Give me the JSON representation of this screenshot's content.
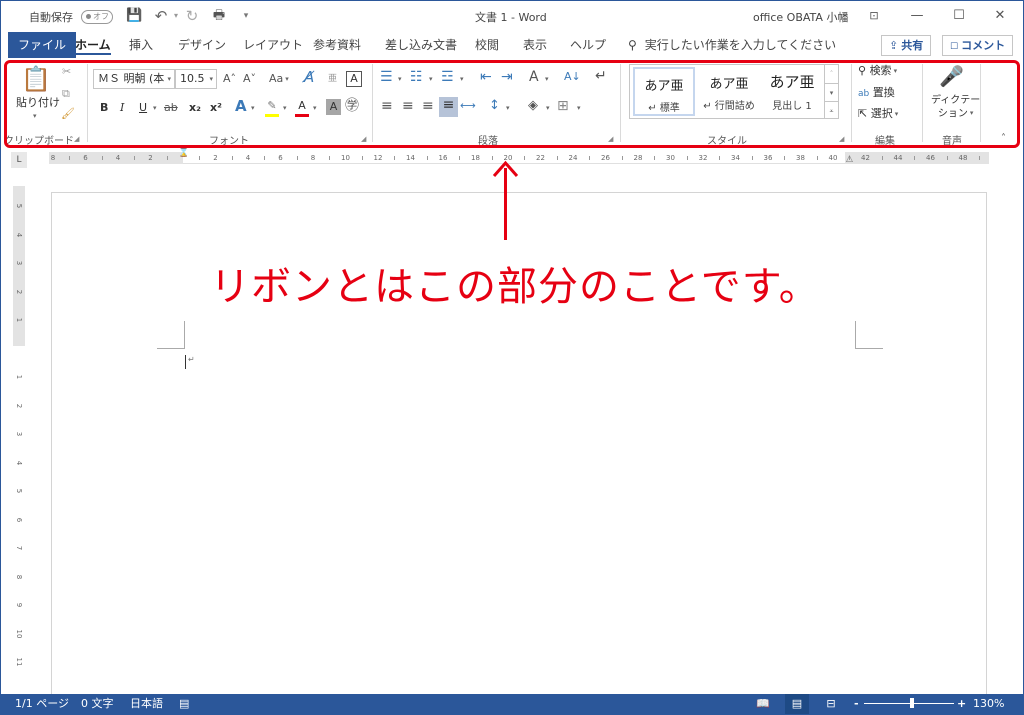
{
  "titlebar": {
    "autosave_label": "自動保存",
    "autosave_state": "オフ",
    "quick_access": [
      {
        "icon": "save-icon",
        "glyph": "💾"
      },
      {
        "icon": "undo-icon",
        "glyph": "↶"
      },
      {
        "icon": "redo-icon",
        "glyph": "↻"
      },
      {
        "icon": "print-preview-icon",
        "glyph": "🖶"
      },
      {
        "icon": "customize-qat-icon",
        "glyph": "▾"
      }
    ],
    "doc_title": "文書 1  -  Word",
    "user_name": "office OBATA 小幡",
    "ribbon_display_glyph": "⊡",
    "minimize_glyph": "—",
    "maximize_glyph": "☐",
    "close_glyph": "✕"
  },
  "tabs": [
    {
      "label": "ファイル",
      "id": "file"
    },
    {
      "label": "ホーム",
      "id": "home",
      "active": true
    },
    {
      "label": "挿入",
      "id": "insert"
    },
    {
      "label": "デザイン",
      "id": "design"
    },
    {
      "label": "レイアウト",
      "id": "layout"
    },
    {
      "label": "参考資料",
      "id": "references"
    },
    {
      "label": "差し込み文書",
      "id": "mailings"
    },
    {
      "label": "校閲",
      "id": "review"
    },
    {
      "label": "表示",
      "id": "view"
    },
    {
      "label": "ヘルプ",
      "id": "help"
    }
  ],
  "tell_me": {
    "icon": "search-icon",
    "glyph": "⚲",
    "placeholder": "実行したい作業を入力してください"
  },
  "share_button": {
    "glyph": "⇪",
    "label": "共有"
  },
  "comment_button": {
    "glyph": "☐",
    "label": "コメント"
  },
  "ribbon": {
    "groups": {
      "clipboard": "クリップボード",
      "font": "フォント",
      "paragraph": "段落",
      "styles": "スタイル",
      "editing": "編集",
      "voice": "音声"
    },
    "clipboard": {
      "paste_label": "貼り付け",
      "paste_glyph": "📋",
      "cut_glyph": "✂",
      "copy_glyph": "⧉",
      "format_painter_glyph": "🖌"
    },
    "font": {
      "font_name": "ＭＳ 明朝 (本",
      "font_size": "10.5",
      "grow_glyph": "A˄",
      "shrink_glyph": "A˅",
      "change_case_label": "Aa",
      "clear_format_glyph": "A̸",
      "phonetic_glyph": "亜",
      "char_border_glyph": "A",
      "bold": "B",
      "italic": "I",
      "underline": "U",
      "strikethrough": "ab",
      "subscript": "x₂",
      "superscript": "x²",
      "text_effects_glyph": "A",
      "highlight_glyph": "✎",
      "font_color_glyph": "A",
      "char_shading_glyph": "A",
      "enclose_glyph": "㊫",
      "highlight_color": "#ffff00",
      "font_color": "#e60012"
    },
    "paragraph": {
      "bullets_glyph": "☰",
      "numbering_glyph": "☷",
      "multilevel_glyph": "☲",
      "decrease_indent_glyph": "⇤",
      "increase_indent_glyph": "⇥",
      "asian_layout_glyph": "A",
      "sort_glyph": "A↓",
      "show_marks_glyph": "↵",
      "align_left_glyph": "≡",
      "align_center_glyph": "≡",
      "align_right_glyph": "≡",
      "justify_glyph": "≡",
      "distributed_glyph": "⟷",
      "line_spacing_glyph": "↕",
      "shading_glyph": "◈",
      "borders_glyph": "⊞"
    },
    "styles": [
      {
        "preview": "あア亜",
        "name": "↵ 標準",
        "selected": true
      },
      {
        "preview": "あア亜",
        "name": "↵ 行間詰め",
        "selected": false
      },
      {
        "preview": "あア亜",
        "name": "見出し 1",
        "selected": false
      }
    ],
    "editing": {
      "find_label": "検索",
      "find_glyph": "⚲",
      "replace_label": "置換",
      "replace_glyph": "ab",
      "select_label": "選択",
      "select_glyph": "⇱"
    },
    "voice": {
      "dictate_label_1": "ディクテー",
      "dictate_label_2": "ション",
      "mic_glyph": "🎤"
    },
    "collapse_glyph": "˄"
  },
  "ruler": {
    "corner_glyph": "L",
    "horizontal_labels": [
      "8",
      "6",
      "4",
      "2",
      "",
      "2",
      "4",
      "6",
      "8",
      "10",
      "12",
      "14",
      "16",
      "18",
      "20",
      "22",
      "24",
      "26",
      "28",
      "30",
      "32",
      "34",
      "36",
      "38",
      "40",
      "42",
      "44",
      "46",
      "48"
    ],
    "vertical_labels": [
      "5",
      "4",
      "3",
      "2",
      "1",
      "",
      "1",
      "2",
      "3",
      "4",
      "5",
      "6",
      "7",
      "8",
      "9",
      "10",
      "11"
    ]
  },
  "document": {
    "paragraph_mark": "↵"
  },
  "annotation": {
    "text": "リボンとはこの部分のことです。",
    "color": "#e60012"
  },
  "statusbar": {
    "page": "1/1 ページ",
    "words": "0 文字",
    "language": "日本語",
    "proofing_glyph": "▤",
    "read_mode_glyph": "📖",
    "print_layout_glyph": "▤",
    "web_layout_glyph": "⊟",
    "zoom_out": "-",
    "zoom_in": "+",
    "zoom_level": "130%",
    "zoom_percent": 130
  }
}
